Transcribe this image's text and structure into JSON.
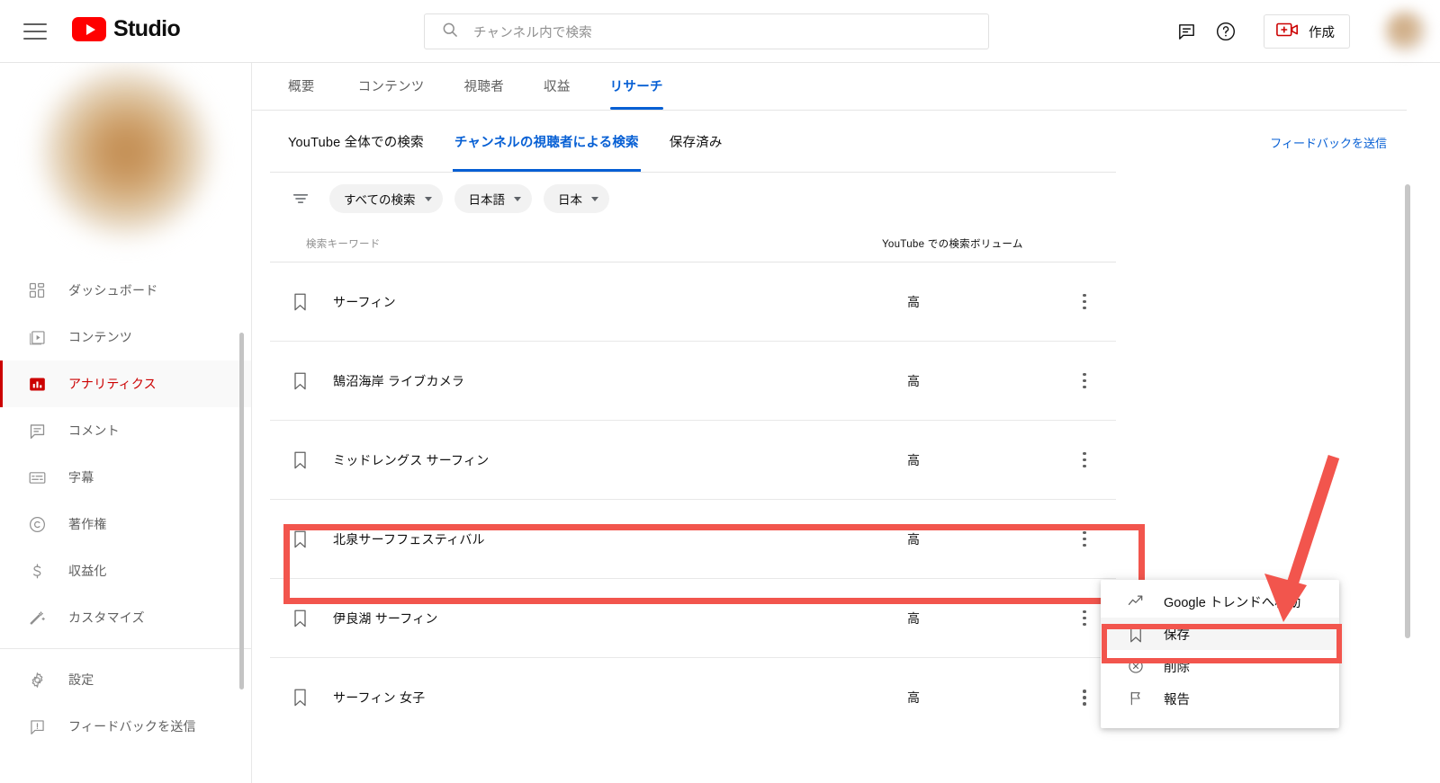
{
  "topbar": {
    "brand": "Studio",
    "search_placeholder": "チャンネル内で検索",
    "create_label": "作成",
    "icons": {
      "menu": "hamburger-icon",
      "search": "search-icon",
      "feedback": "feedback-icon",
      "help": "help-icon",
      "create": "create-video-icon"
    }
  },
  "sidebar": {
    "items": [
      {
        "label": "ダッシュボード",
        "icon": "dashboard-icon",
        "active": false
      },
      {
        "label": "コンテンツ",
        "icon": "content-video-icon",
        "active": false
      },
      {
        "label": "アナリティクス",
        "icon": "analytics-bar-icon",
        "active": true
      },
      {
        "label": "コメント",
        "icon": "comment-icon",
        "active": false
      },
      {
        "label": "字幕",
        "icon": "subtitles-icon",
        "active": false
      },
      {
        "label": "著作権",
        "icon": "copyright-icon",
        "active": false
      },
      {
        "label": "収益化",
        "icon": "monetization-dollar-icon",
        "active": false
      },
      {
        "label": "カスタマイズ",
        "icon": "customize-wand-icon",
        "active": false
      }
    ],
    "footer_items": [
      {
        "label": "設定",
        "icon": "gear-icon"
      },
      {
        "label": "フィードバックを送信",
        "icon": "feedback-flag-icon"
      }
    ]
  },
  "analytics_tabs": [
    {
      "label": "概要",
      "selected": false
    },
    {
      "label": "コンテンツ",
      "selected": false
    },
    {
      "label": "視聴者",
      "selected": false
    },
    {
      "label": "収益",
      "selected": false
    },
    {
      "label": "リサーチ",
      "selected": true
    }
  ],
  "research_tabs": [
    {
      "label": "YouTube 全体での検索",
      "selected": false
    },
    {
      "label": "チャンネルの視聴者による検索",
      "selected": true
    },
    {
      "label": "保存済み",
      "selected": false
    }
  ],
  "feedback_link": "フィードバックを送信",
  "filters": [
    {
      "label": "すべての検索"
    },
    {
      "label": "日本語"
    },
    {
      "label": "日本"
    }
  ],
  "table": {
    "headers": {
      "keyword": "検索キーワード",
      "volume": "YouTube での検索ボリューム"
    },
    "rows": [
      {
        "keyword": "サーフィン",
        "volume": "高",
        "highlighted": false
      },
      {
        "keyword": "鵠沼海岸 ライブカメラ",
        "volume": "高",
        "highlighted": false
      },
      {
        "keyword": "ミッドレングス サーフィン",
        "volume": "高",
        "highlighted": false
      },
      {
        "keyword": "北泉サーフフェスティバル",
        "volume": "高",
        "highlighted": true
      },
      {
        "keyword": "伊良湖 サーフィン",
        "volume": "高",
        "highlighted": false
      },
      {
        "keyword": "サーフィン 女子",
        "volume": "高",
        "highlighted": false
      }
    ]
  },
  "context_menu": {
    "items": [
      {
        "label": "Google トレンドへ移動",
        "icon": "trending-up-icon",
        "highlighted": false
      },
      {
        "label": "保存",
        "icon": "bookmark-icon",
        "highlighted": true
      },
      {
        "label": "削除",
        "icon": "remove-circle-icon",
        "highlighted": false
      },
      {
        "label": "報告",
        "icon": "flag-icon",
        "highlighted": false
      }
    ]
  },
  "annotations": {
    "accent_red": "#f2554d",
    "arrow": "red-arrow-pointing-down-left"
  },
  "colors": {
    "brand_red": "#ff0000",
    "active_red": "#cc0000",
    "link_blue": "#065fd4",
    "text_primary": "#0f0f0f",
    "text_secondary": "#606060"
  }
}
